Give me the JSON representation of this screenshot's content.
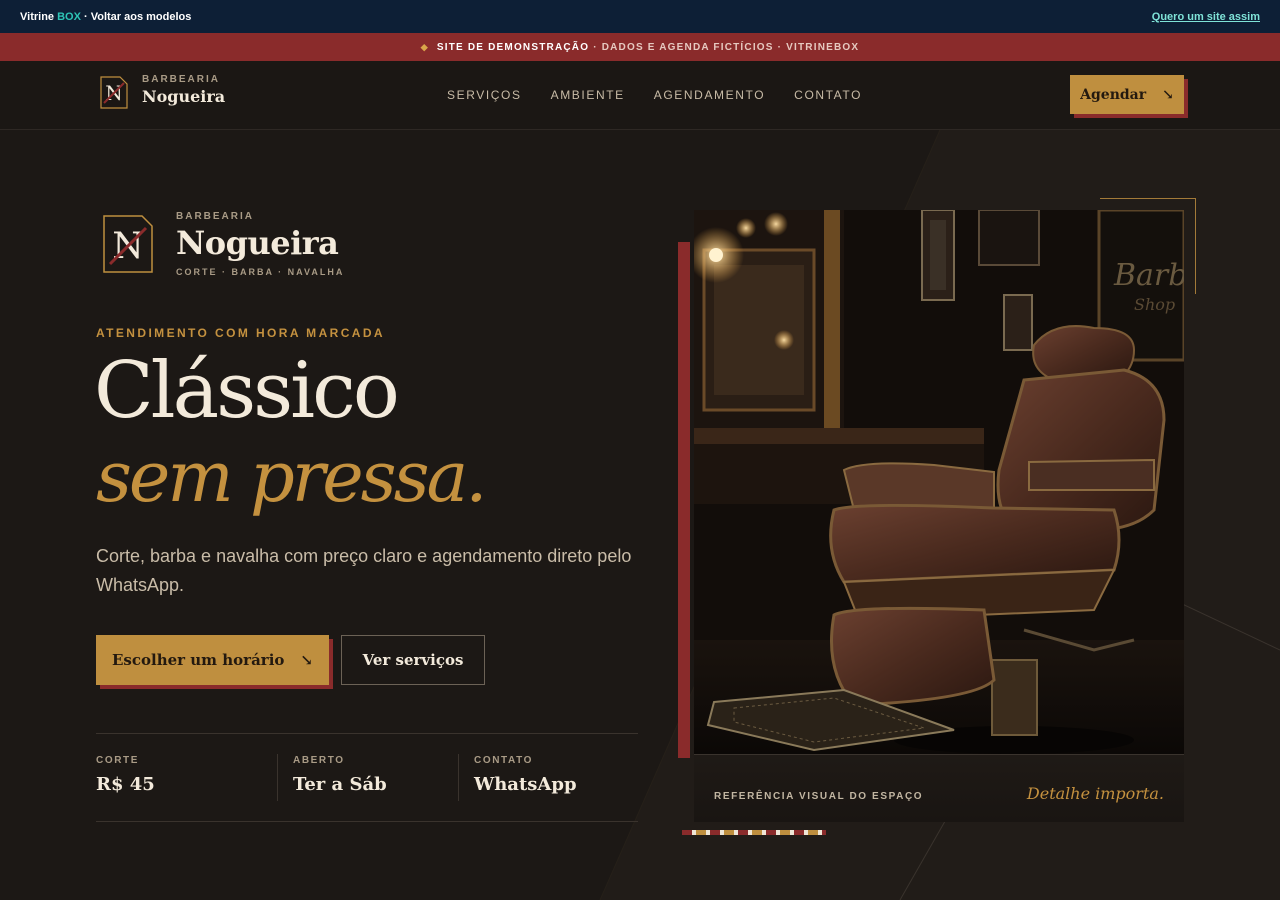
{
  "vitrine_bar": {
    "brand_part1": "Vitrine ",
    "brand_accent": "BOX",
    "back_text": " · Voltar aos modelos",
    "cta_link": "Quero um site assim"
  },
  "demo_strip": {
    "label_strong": "SITE DE DEMONSTRAÇÃO",
    "label_rest": "· DADOS E AGENDA FICTÍCIOS · VITRINEBOX"
  },
  "header": {
    "logo_subtitle": "BARBEARIA",
    "logo_name": "Nogueira",
    "nav": [
      "SERVIÇOS",
      "AMBIENTE",
      "AGENDAMENTO",
      "CONTATO"
    ],
    "cta_label": "Agendar",
    "cta_arrow": "↘"
  },
  "hero": {
    "logo_subtitle": "BARBEARIA",
    "logo_name": "Nogueira",
    "logo_tagline": "CORTE · BARBA · NAVALHA",
    "eyebrow": "ATENDIMENTO COM HORA MARCADA",
    "title_line1": "Clássico",
    "title_line2": "sem pressa.",
    "lead": "Corte, barba e navalha com preço claro e agendamento direto pelo WhatsApp.",
    "primary_cta": "Escolher um horário",
    "primary_arrow": "↘",
    "secondary_cta": "Ver serviços",
    "facts": [
      {
        "label": "CORTE",
        "value": "R$ 45"
      },
      {
        "label": "ABERTO",
        "value": "Ter a Sáb"
      },
      {
        "label": "CONTATO",
        "value": "WhatsApp"
      }
    ],
    "photo_caption_left": "REFERÊNCIA VISUAL DO ESPAÇO",
    "photo_caption_right": "Detalhe importa.",
    "photo_sign_line1": "Barbe",
    "photo_sign_line2": "Shop"
  },
  "colors": {
    "top_bar": "#0d1f36",
    "demo_strip": "#8a2b2b",
    "background": "#1c1815",
    "gold": "#bf8f3f",
    "cream": "#f3eadb",
    "burgundy": "#8a2b2b"
  }
}
